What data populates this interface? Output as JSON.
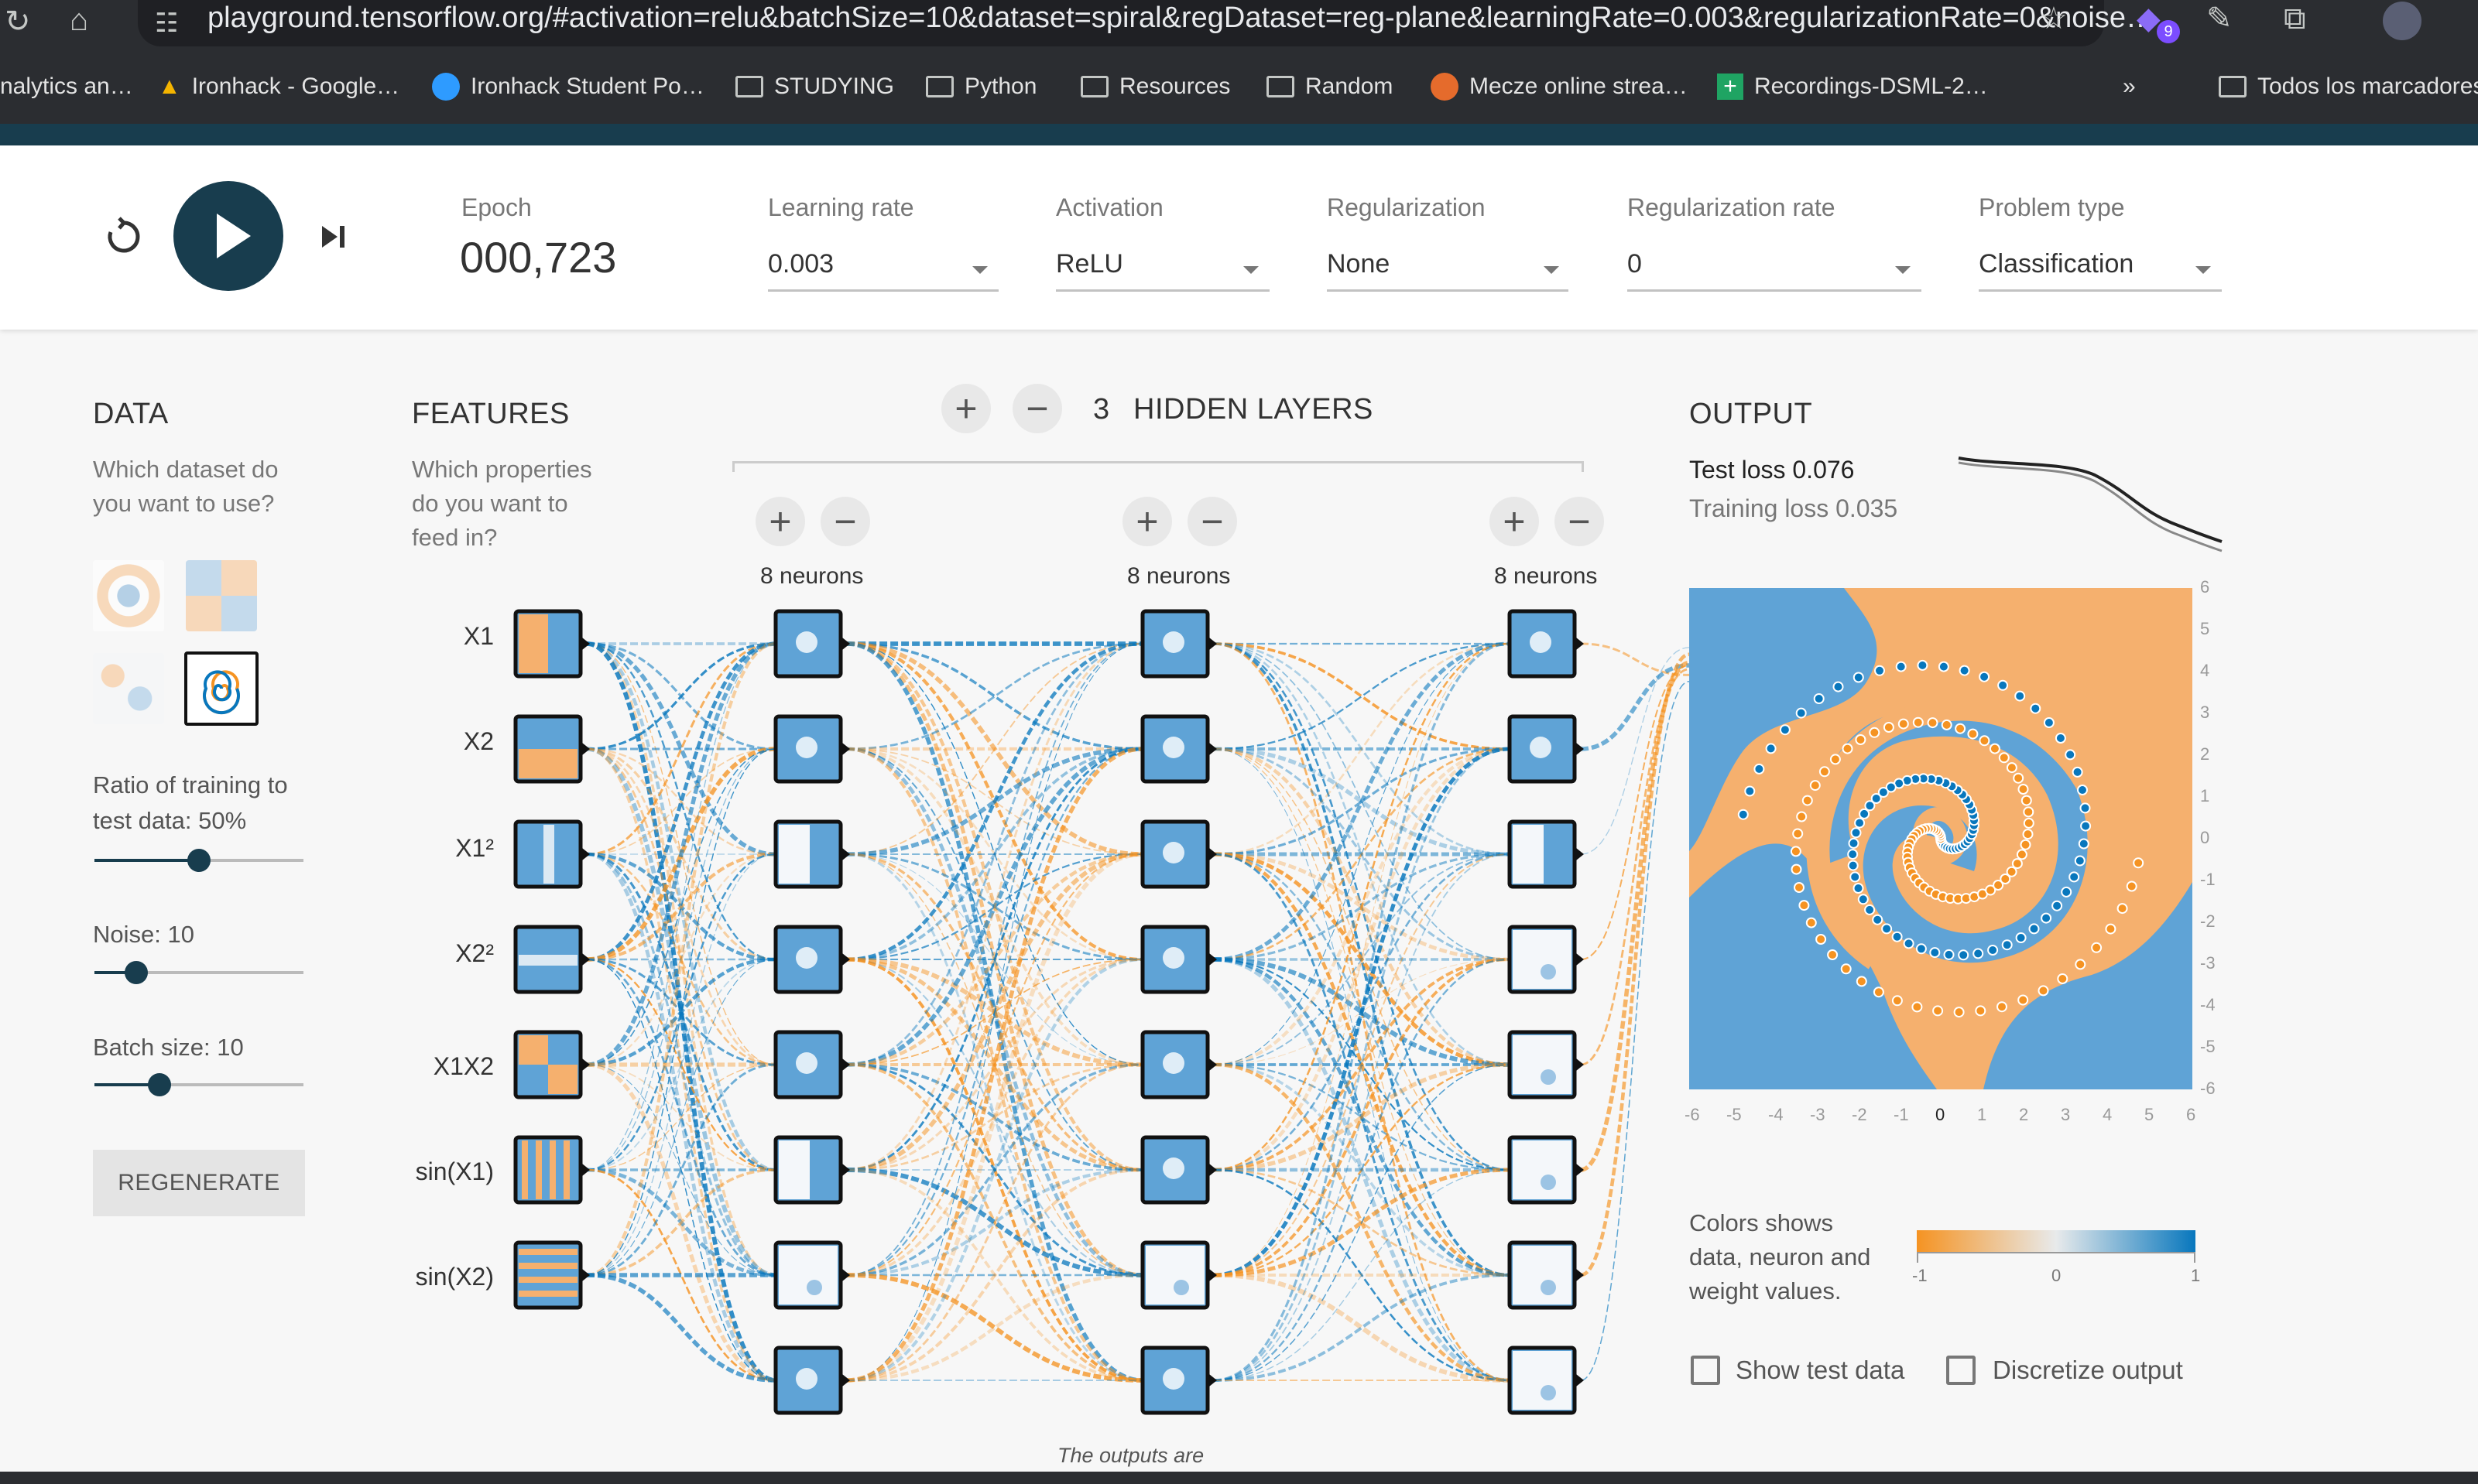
{
  "browser": {
    "url": "playground.tensorflow.org/#activation=relu&batchSize=10&dataset=spiral&regDataset=reg-plane&learningRate=0.003&regularizationRate=0&noise…",
    "extension_badge": "9",
    "bookmarks": [
      "nalytics an…",
      "Ironhack - Google…",
      "Ironhack Student Po…",
      "STUDYING",
      "Python",
      "Resources",
      "Random",
      "Mecze online strea…",
      "Recordings-DSML-2…"
    ],
    "overflow": "»",
    "all_bookmarks": "Todos los marcadores"
  },
  "controls": {
    "epoch_label": "Epoch",
    "epoch_value": "000,723",
    "learning_rate_label": "Learning rate",
    "learning_rate_value": "0.003",
    "activation_label": "Activation",
    "activation_value": "ReLU",
    "regularization_label": "Regularization",
    "regularization_value": "None",
    "regularization_rate_label": "Regularization rate",
    "regularization_rate_value": "0",
    "problem_type_label": "Problem type",
    "problem_type_value": "Classification"
  },
  "data_panel": {
    "title": "DATA",
    "description_line1": "Which dataset do",
    "description_line2": "you want to use?",
    "ratio_label_line1": "Ratio of training to",
    "ratio_label_line2": "test data:  50%",
    "ratio_fraction": 0.5,
    "noise_label": "Noise:  10",
    "noise_fraction": 0.2,
    "batch_label": "Batch size:  10",
    "batch_fraction": 0.31,
    "regenerate": "REGENERATE",
    "selected_dataset": "spiral"
  },
  "features_panel": {
    "title": "FEATURES",
    "description_line1": "Which properties",
    "description_line2": "do you want to",
    "description_line3": "feed in?",
    "features": [
      "X1",
      "X2",
      "X1²",
      "X2²",
      "X1X2",
      "sin(X1)",
      "sin(X2)"
    ]
  },
  "network": {
    "layer_count": "3",
    "hidden_layers_label": "HIDDEN LAYERS",
    "plus": "+",
    "minus": "−",
    "neuron_labels": [
      "8 neurons",
      "8 neurons",
      "8 neurons"
    ],
    "outputs_note": "The outputs are"
  },
  "output_panel": {
    "title": "OUTPUT",
    "test_loss": "Test loss 0.076",
    "training_loss": "Training loss 0.035",
    "x_ticks": [
      "-6",
      "-5",
      "-4",
      "-3",
      "-2",
      "-1",
      "0",
      "1",
      "2",
      "3",
      "4",
      "5",
      "6"
    ],
    "y_ticks": [
      "6",
      "5",
      "4",
      "3",
      "2",
      "1",
      "0",
      "-1",
      "-2",
      "-3",
      "-4",
      "-5",
      "-6"
    ],
    "legend_line1": "Colors shows",
    "legend_line2": "data, neuron and",
    "legend_line3": "weight values.",
    "legend_min": "-1",
    "legend_mid": "0",
    "legend_max": "1",
    "show_test_data": "Show test data",
    "discretize_output": "Discretize output"
  },
  "colors": {
    "orange": "#f59322",
    "blue": "#0877bd",
    "dark": "#183d4e"
  }
}
